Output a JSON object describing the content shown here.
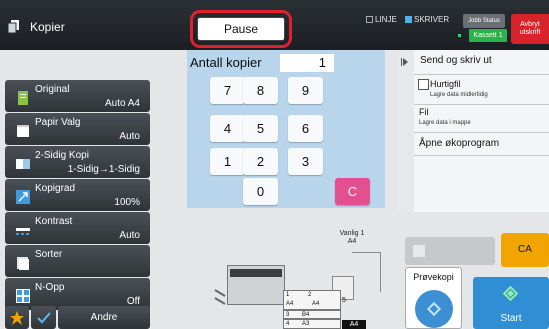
{
  "header": {
    "app_title": "Kopier",
    "pause_label": "Pause",
    "mode_linje": "LINJE",
    "mode_skriver": "SKRIVER",
    "job_status_label": "Jobb Status",
    "kassett_label": "Kassett 1",
    "cancel_label_line1": "Avbryt",
    "cancel_label_line2": "utskrift"
  },
  "copies": {
    "label": "Antall kopier",
    "value": "1",
    "keys": [
      "7",
      "8",
      "9",
      "4",
      "5",
      "6",
      "1",
      "2",
      "3",
      "0"
    ],
    "clear_label": "C"
  },
  "left_menu": {
    "items": [
      {
        "label": "Original",
        "value": "Auto A4"
      },
      {
        "label": "Papir Valg",
        "value": "Auto"
      },
      {
        "label": "2-Sidig Kopi",
        "value": "1-Sidig→1-Sidig"
      },
      {
        "label": "Kopigrad",
        "value": "100%"
      },
      {
        "label": "Kontrast",
        "value": "Auto"
      },
      {
        "label": "Sorter",
        "value": ""
      },
      {
        "label": "N-Opp",
        "value": "Off"
      }
    ],
    "other_label": "Andre"
  },
  "right_panel": {
    "send_label": "Send og skriv ut",
    "hurtigfil_label": "Hurtigfil",
    "hurtigfil_sub": "Lagre data midlertidig",
    "fil_label": "Fil",
    "fil_sub": "Lagre data i mappe",
    "oko_label": "Åpne økoprogram"
  },
  "preview": {
    "output_label_line1": "Vanlig 1",
    "output_label_line2": "A4",
    "trays": [
      {
        "num": "1",
        "size": "A4"
      },
      {
        "num": "2",
        "size": "A4"
      },
      {
        "num": "3",
        "size": "B4"
      },
      {
        "num": "4",
        "size": "A3"
      }
    ],
    "tray5_num": "5",
    "selected_size": "A4"
  },
  "actions": {
    "ca_label": "CA",
    "sample_label": "Prøvekopi",
    "start_label": "Start"
  },
  "colors": {
    "pause_highlight": "#e0202a",
    "clear_key": "#e4508f",
    "ca_button": "#f2a500",
    "start_button": "#2f8ed4",
    "kassett": "#2cb24a",
    "cancel_button": "#d9232b"
  }
}
